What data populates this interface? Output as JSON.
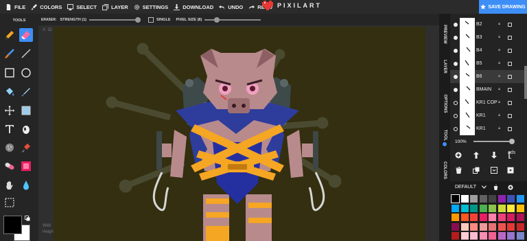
{
  "menu": [
    {
      "label": "FILE",
      "icon": "file-icon"
    },
    {
      "label": "COLORS",
      "icon": "brush-icon"
    },
    {
      "label": "SELECT",
      "icon": "select-icon"
    },
    {
      "label": "LAYER",
      "icon": "layer-icon"
    },
    {
      "label": "SETTINGS",
      "icon": "gear-icon"
    },
    {
      "label": "DOWNLOAD",
      "icon": "download-icon"
    },
    {
      "label": "UNDO",
      "icon": "undo-icon"
    },
    {
      "label": "REDO",
      "icon": "redo-icon"
    }
  ],
  "app_name": "PIXILART",
  "save_label": "SAVE DRAWING",
  "tools_title": "TOOLS",
  "subbar": {
    "tool_label": "ERASER:",
    "strength_label": "STRENGTH (1)",
    "single_label": "SINGLE",
    "pixel_size_label": "PIXEL SIZE (8)"
  },
  "canvas": {
    "coord_text": "X: 32",
    "width_text": "Widt",
    "height_text": "Heigh"
  },
  "side_tabs": [
    "PREVIEW",
    "LAYER",
    "OPTIONS",
    "TOOL",
    "COLORS"
  ],
  "layers": [
    {
      "name": "B2",
      "visible": true
    },
    {
      "name": "B3",
      "visible": true
    },
    {
      "name": "B4",
      "visible": true
    },
    {
      "name": "B5",
      "visible": true
    },
    {
      "name": "B6",
      "visible": true,
      "active": true
    },
    {
      "name": "BMAIN",
      "visible": true
    },
    {
      "name": "KR1 COP",
      "visible": false
    },
    {
      "name": "KR1",
      "visible": false
    },
    {
      "name": "KR1",
      "visible": false
    }
  ],
  "opacity_label": "100%",
  "ads_label": "ads",
  "palette_name": "DEFAULT",
  "colors": {
    "accent": "#3d8ef7",
    "canvas_bg": "#332f10",
    "palette": [
      "#000000",
      "#ffffff",
      "#9e9e9e",
      "#616161",
      "#424242",
      "#8e24aa",
      "#3f51b5",
      "#2196f3",
      "#03a9f4",
      "#00bcd4",
      "#009688",
      "#4caf50",
      "#8bc34a",
      "#cddc39",
      "#ffeb3b",
      "#ffc107",
      "#ff9800",
      "#ff5722",
      "#f44336",
      "#e91e63",
      "#ff80ab",
      "#ec407a",
      "#d81b60",
      "#ad1457",
      "#880e4f",
      "#ffccbc",
      "#ff8a80",
      "#ef9a9a",
      "#e57373",
      "#ef5350",
      "#e53935",
      "#c62828",
      "#b71c1c",
      "#ffcdd2",
      "#f8bbd0",
      "#f48fb1",
      "#f06292",
      "#ba68c8",
      "#9575cd",
      "#7986cb"
    ]
  }
}
